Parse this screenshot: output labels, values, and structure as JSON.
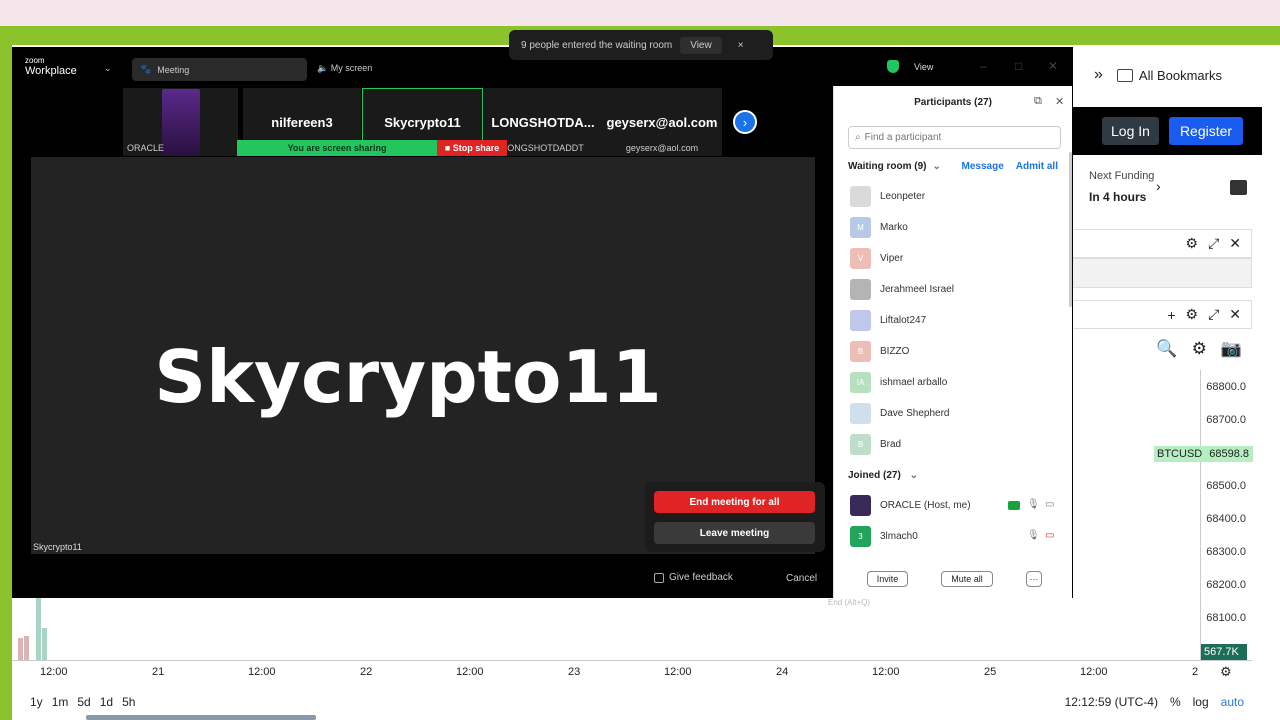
{
  "browser": {
    "bookmarks_overflow": "»",
    "all_bookmarks": "All Bookmarks"
  },
  "site": {
    "login": "Log In",
    "register": "Register",
    "next_funding_label": "Next Funding",
    "next_funding_value": "In 4 hours",
    "symbol_tag": "BTCUSD",
    "last_price": "68598.8",
    "volume_tag": "567.7K",
    "y_ticks": [
      "68800.0",
      "68700.0",
      "68500.0",
      "68400.0",
      "68300.0",
      "68200.0",
      "68100.0"
    ],
    "x_ticks": [
      "12:00",
      "21",
      "12:00",
      "22",
      "12:00",
      "23",
      "12:00",
      "24",
      "12:00",
      "25",
      "12:00",
      "2"
    ],
    "ranges": [
      "1y",
      "1m",
      "5d",
      "1d",
      "5h"
    ],
    "clock": "12:12:59 (UTC-4)",
    "pct": "%",
    "log": "log",
    "auto": "auto"
  },
  "zoom": {
    "brand_small": "zoom",
    "brand": "Workplace",
    "meeting_tab": "Meeting",
    "my_screen": "My screen",
    "view": "View",
    "toast": {
      "text": "9 people entered the waiting room",
      "view": "View",
      "close": "×"
    },
    "tiles": [
      {
        "name": "",
        "sub": "ORACLE"
      },
      {
        "name": "nilfereen3",
        "sub": ""
      },
      {
        "name": "Skycrypto11",
        "sub": ""
      },
      {
        "name": "LONGSHOTDA...",
        "sub": "LONGSHOTDADDT"
      },
      {
        "name": "geyserx@aol.com",
        "sub": "geyserx@aol.com"
      }
    ],
    "sharing": "You are screen sharing",
    "stop_share": "Stop share",
    "video_name": "Skycrypto11",
    "video_label": "Skycrypto11",
    "end_all": "End meeting for all",
    "leave": "Leave meeting",
    "give_feedback": "Give feedback",
    "cancel": "Cancel",
    "end_hint": "End (Alt+Q)",
    "participants": {
      "title": "Participants (27)",
      "search_placeholder": "Find a participant",
      "waiting_header": "Waiting room (9)",
      "message": "Message",
      "admit_all": "Admit all",
      "waiting": [
        {
          "name": "Leonpeter",
          "initial": "",
          "color": "#bbbbbb"
        },
        {
          "name": "Marko",
          "initial": "M",
          "color": "#7d9fd0"
        },
        {
          "name": "Viper",
          "initial": "V",
          "color": "#e08a7a"
        },
        {
          "name": "Jerahmeel Israel",
          "initial": "",
          "color": "#777777"
        },
        {
          "name": "Liftalot247",
          "initial": "",
          "color": "#8a9ad8"
        },
        {
          "name": "BIZZO",
          "initial": "B",
          "color": "#e08a7a"
        },
        {
          "name": "ishmael arballo",
          "initial": "IA",
          "color": "#7ec98a"
        },
        {
          "name": "Dave Shepherd",
          "initial": "",
          "color": "#a8c4dc"
        },
        {
          "name": "Brad",
          "initial": "B",
          "color": "#8cc4a0"
        }
      ],
      "joined_header": "Joined (27)",
      "joined": [
        {
          "name": "ORACLE (Host, me)",
          "initial": "",
          "color": "#3a2a5a"
        },
        {
          "name": "3lmach0",
          "initial": "3",
          "color": "#22a55a"
        }
      ],
      "invite": "Invite",
      "mute_all": "Mute all",
      "more": "···"
    }
  }
}
